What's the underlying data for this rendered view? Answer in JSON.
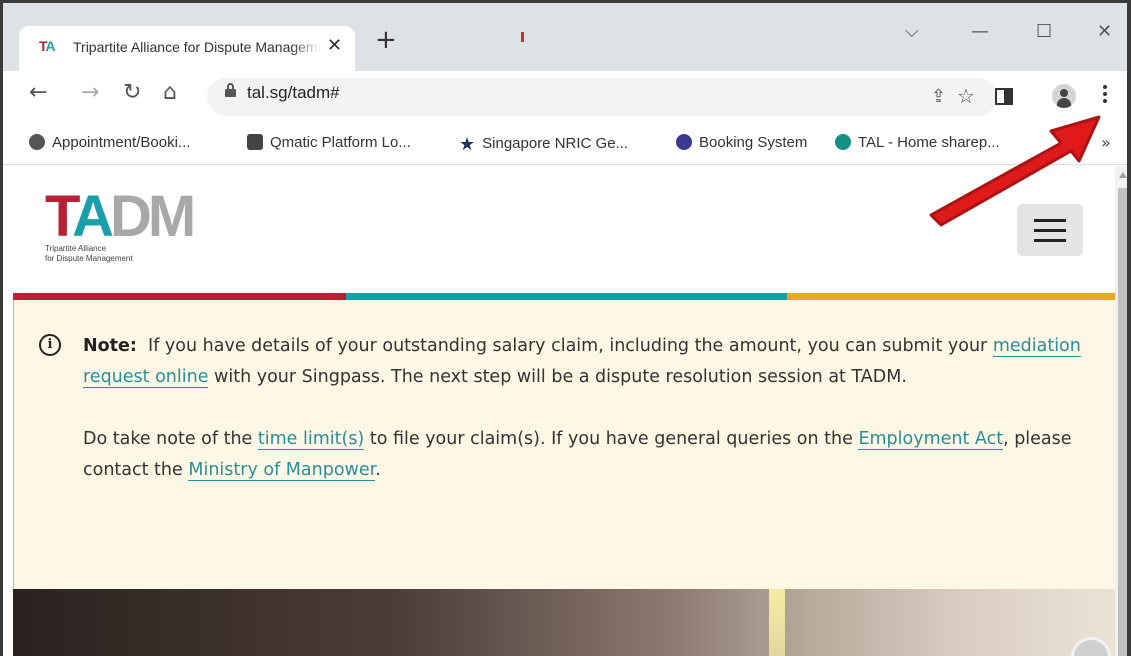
{
  "tab": {
    "favicon": "TA",
    "title": "Tripartite Alliance for Dispute Management",
    "close_icon": "close-icon",
    "new_tab_icon": "plus-icon"
  },
  "window_controls": [
    "chevron-down-icon",
    "minimize-icon",
    "maximize-icon",
    "close-icon"
  ],
  "toolbar": {
    "url": "tal.sg/tadm#"
  },
  "bookmarks": [
    {
      "label": "Appointment/Booki...",
      "icon": "globe-icon"
    },
    {
      "label": "Qmatic Platform Lo...",
      "icon": "qmatic-icon"
    },
    {
      "label": "Singapore NRIC Ge...",
      "icon": "star-icon"
    },
    {
      "label": "Booking System",
      "icon": "booking-icon"
    },
    {
      "label": "TAL - Home sharep...",
      "icon": "sharepoint-icon"
    }
  ],
  "bookmarks_more": "»",
  "site": {
    "logo": {
      "t": "T",
      "a": "A",
      "dm": "DM",
      "line1": "Tripartite Alliance",
      "line2": "for Dispute Management"
    },
    "stripe_colors": [
      "#b52234",
      "#1a9fa8",
      "#e9a623"
    ],
    "note": {
      "label": "Note:",
      "p1_a": "If you have details of your outstanding salary claim, including the amount, you can submit your",
      "link_mediation": "mediation request online",
      "p1_b": "with your Singpass. The next step will be a dispute resolution session at TADM.",
      "p2_a": "Do take note of the",
      "link_time_limit": "time limit(s)",
      "p2_b": "to file your claim(s). If you have general queries on the",
      "link_employment_act": "Employment Act",
      "p2_c": ", please contact the",
      "link_mom": "Ministry of Manpower",
      "p2_d": "."
    }
  },
  "annotation_color": "#e0191b"
}
